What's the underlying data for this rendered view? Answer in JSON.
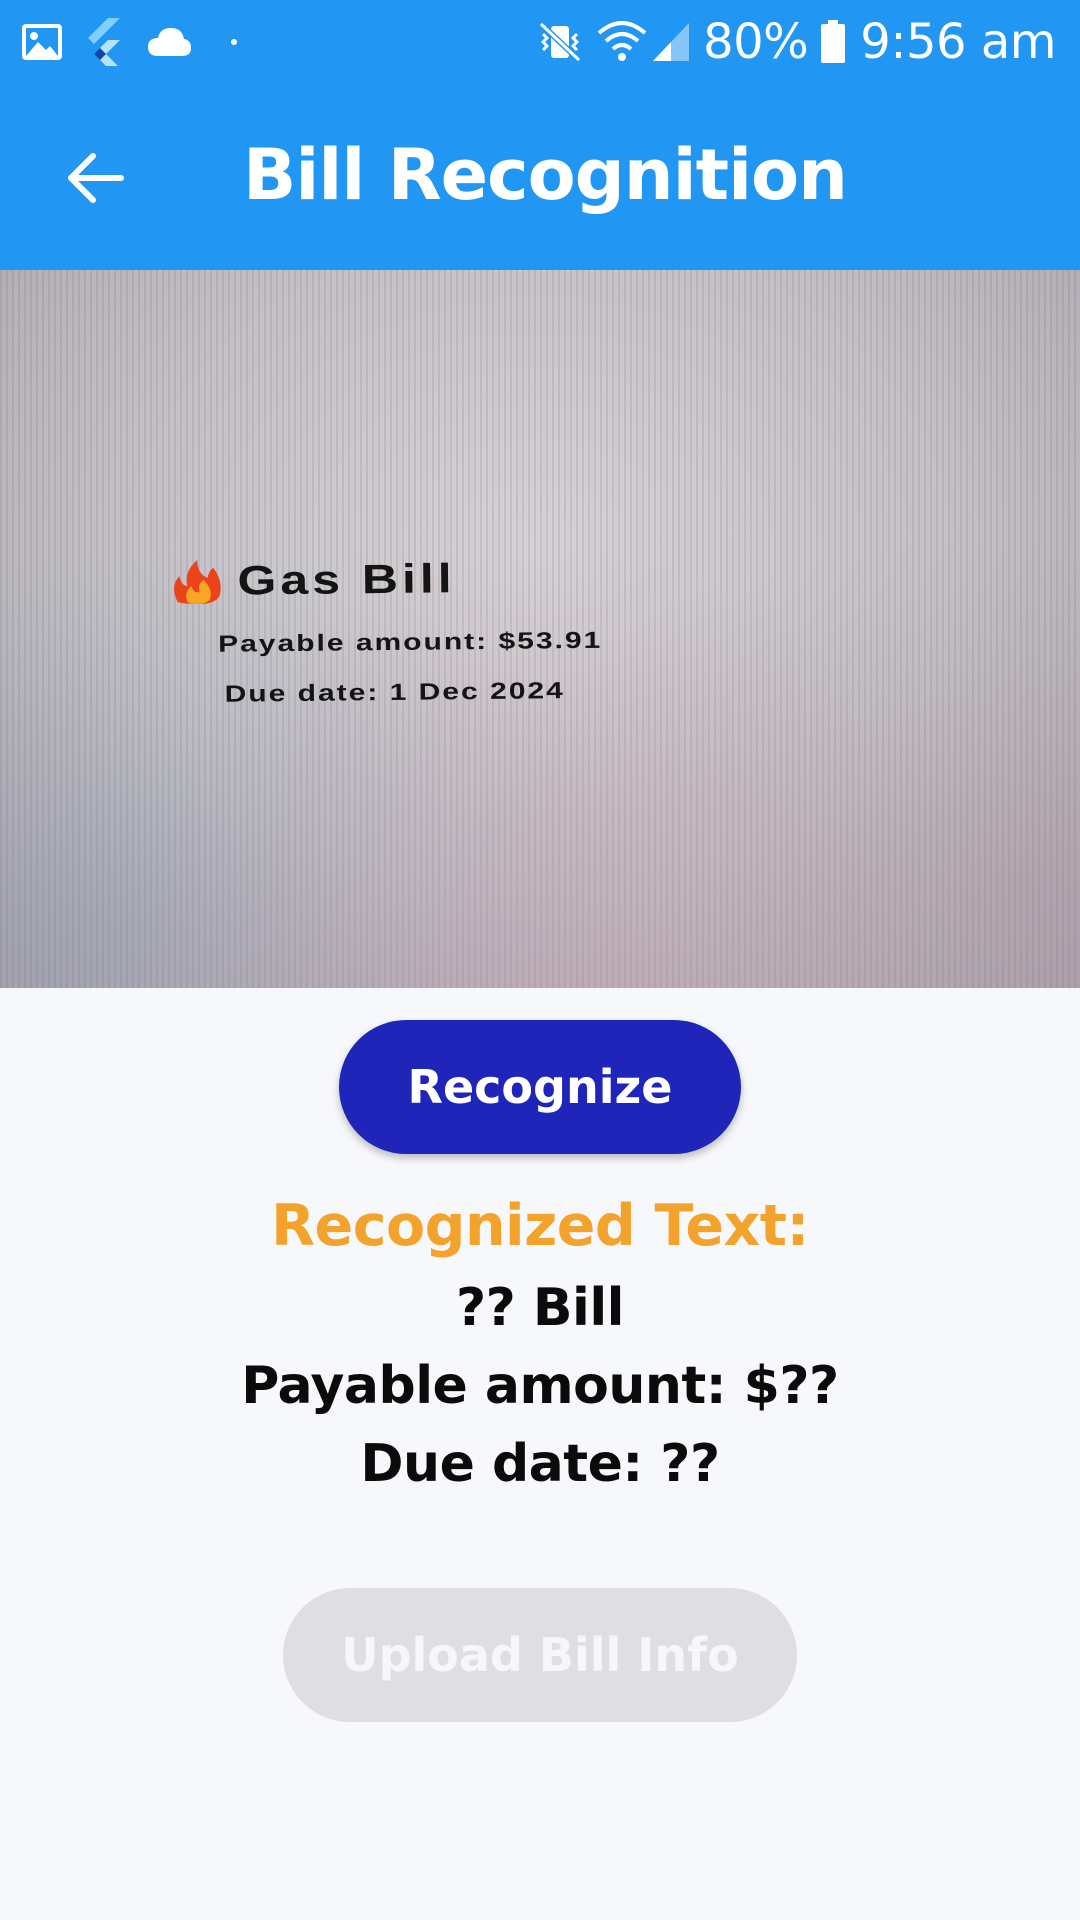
{
  "status_bar": {
    "battery": "80%",
    "time": "9:56 am",
    "left_icons": [
      "image-icon",
      "flutter-icon",
      "cloud-icon",
      "dot-icon"
    ],
    "right_icons": [
      "vibrate-mute-icon",
      "wifi-icon",
      "signal-icon",
      "battery-icon"
    ]
  },
  "app_bar": {
    "title": "Bill Recognition",
    "back_icon": "arrow-left-icon",
    "color": "#2196f3"
  },
  "bill_photo": {
    "title": "Gas Bill",
    "amount_line": "Payable amount: $53.91",
    "due_line": "Due date: 1 Dec 2024"
  },
  "actions": {
    "recognize_label": "Recognize",
    "recognize_color": "#1f25b8",
    "upload_label": "Upload Bill Info",
    "upload_enabled": false
  },
  "result": {
    "heading": "Recognized Text:",
    "heading_color": "#f3a22b",
    "lines": [
      "?? Bill",
      "Payable amount: $??",
      "Due date: ??"
    ]
  }
}
